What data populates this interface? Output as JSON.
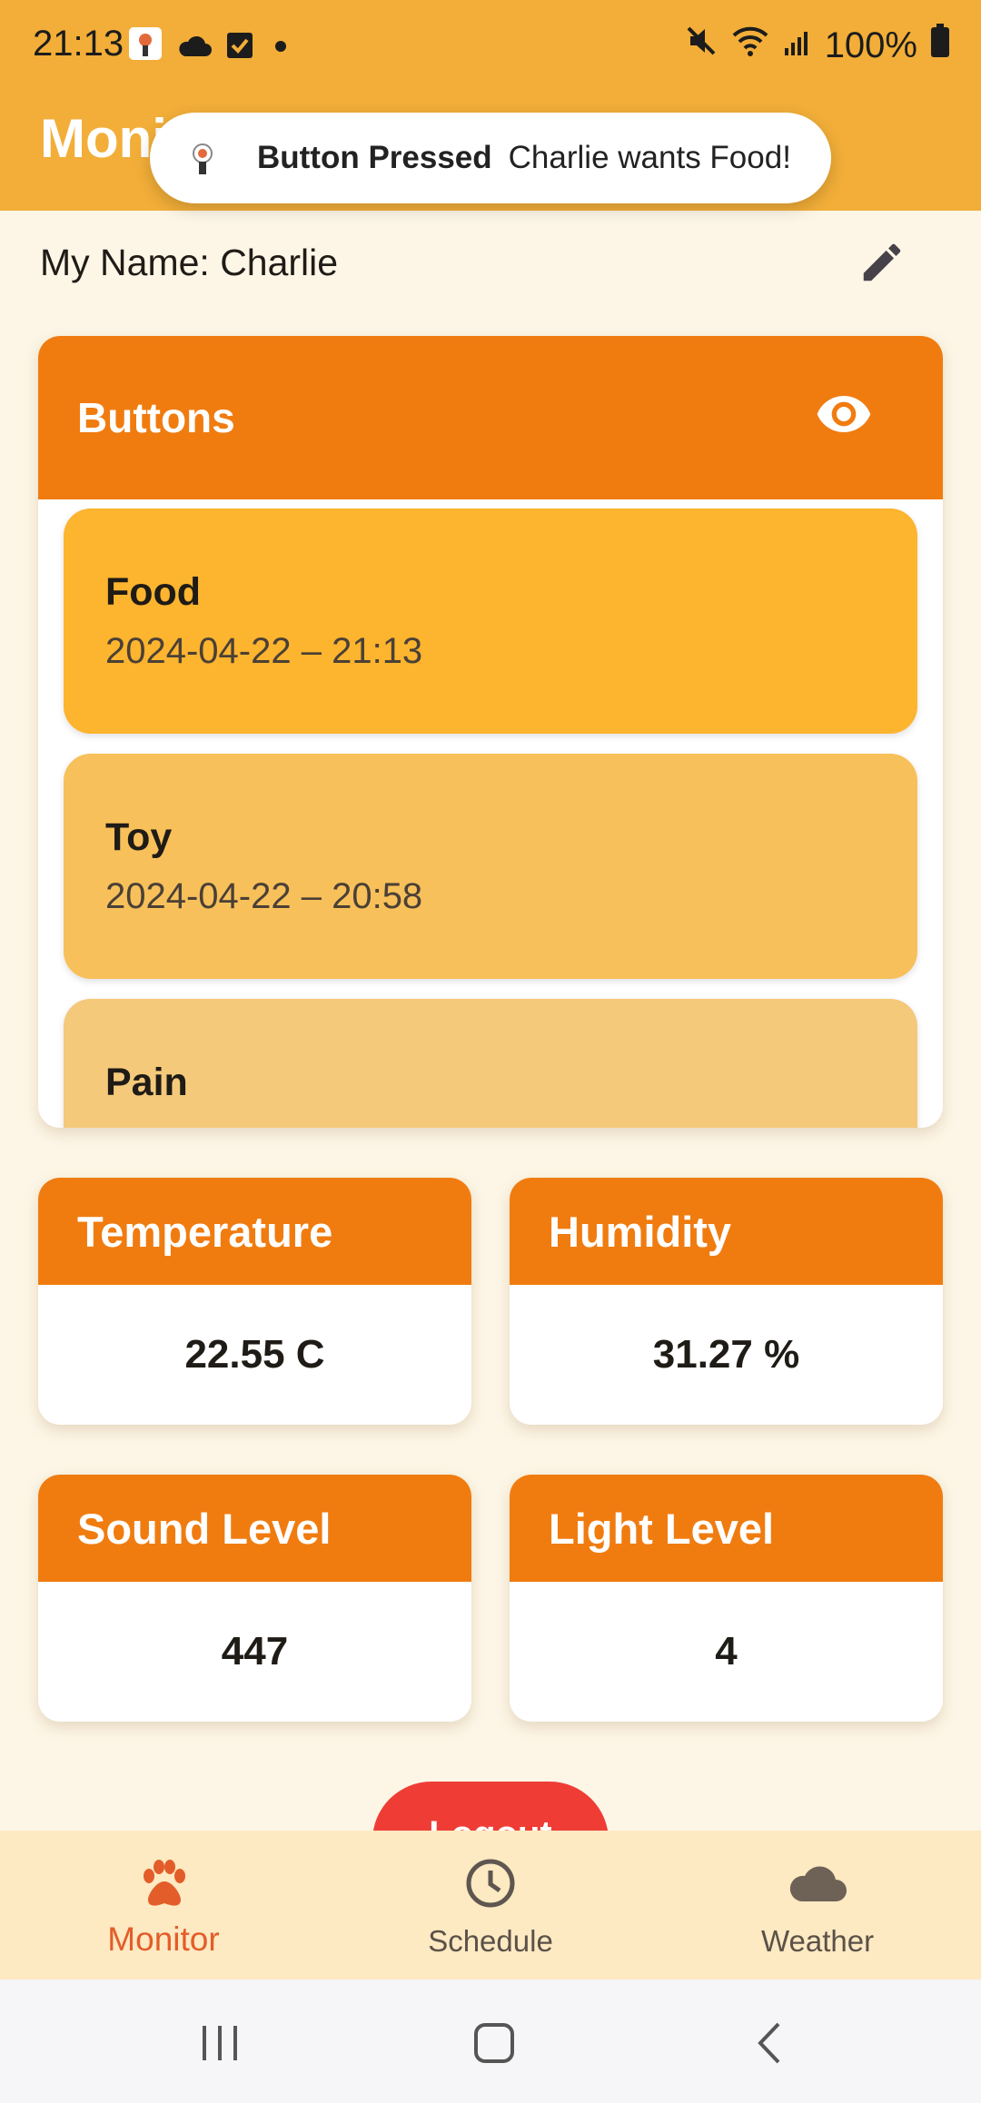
{
  "status_bar": {
    "time": "21:13",
    "battery_percent": "100%",
    "icons_left": [
      "app-notification-icon",
      "cloud-icon",
      "checkbox-icon",
      "dot-icon"
    ],
    "icons_right": [
      "mute-icon",
      "wifi-icon",
      "signal-icon",
      "battery-icon"
    ]
  },
  "app_bar": {
    "title": "Moni"
  },
  "toast": {
    "title": "Button Pressed",
    "message": "Charlie wants Food!"
  },
  "profile": {
    "name_label": "My Name: Charlie"
  },
  "buttons_card": {
    "title": "Buttons",
    "items": [
      {
        "name": "Food",
        "time": "2024-04-22 – 21:13",
        "color": "#FDB42E"
      },
      {
        "name": "Toy",
        "time": "2024-04-22 – 20:58",
        "color": "#F8C05A"
      },
      {
        "name": "Pain",
        "time": "",
        "color": "#F4C97A"
      }
    ]
  },
  "sensors": [
    {
      "title": "Temperature",
      "value": "22.55 C"
    },
    {
      "title": "Humidity",
      "value": "31.27 %"
    },
    {
      "title": "Sound Level",
      "value": "447"
    },
    {
      "title": "Light Level",
      "value": "4"
    }
  ],
  "logout": {
    "label": "Logout"
  },
  "bottom_nav": {
    "items": [
      {
        "label": "Monitor",
        "icon": "paw-icon",
        "active": true
      },
      {
        "label": "Schedule",
        "icon": "clock-icon",
        "active": false
      },
      {
        "label": "Weather",
        "icon": "cloud-icon",
        "active": false
      }
    ]
  },
  "colors": {
    "app_bar": "#F2AE38",
    "header_orange": "#F07C10",
    "logout_red": "#EF3D36",
    "active_nav": "#E35D2A",
    "background": "#FDF6E6"
  }
}
